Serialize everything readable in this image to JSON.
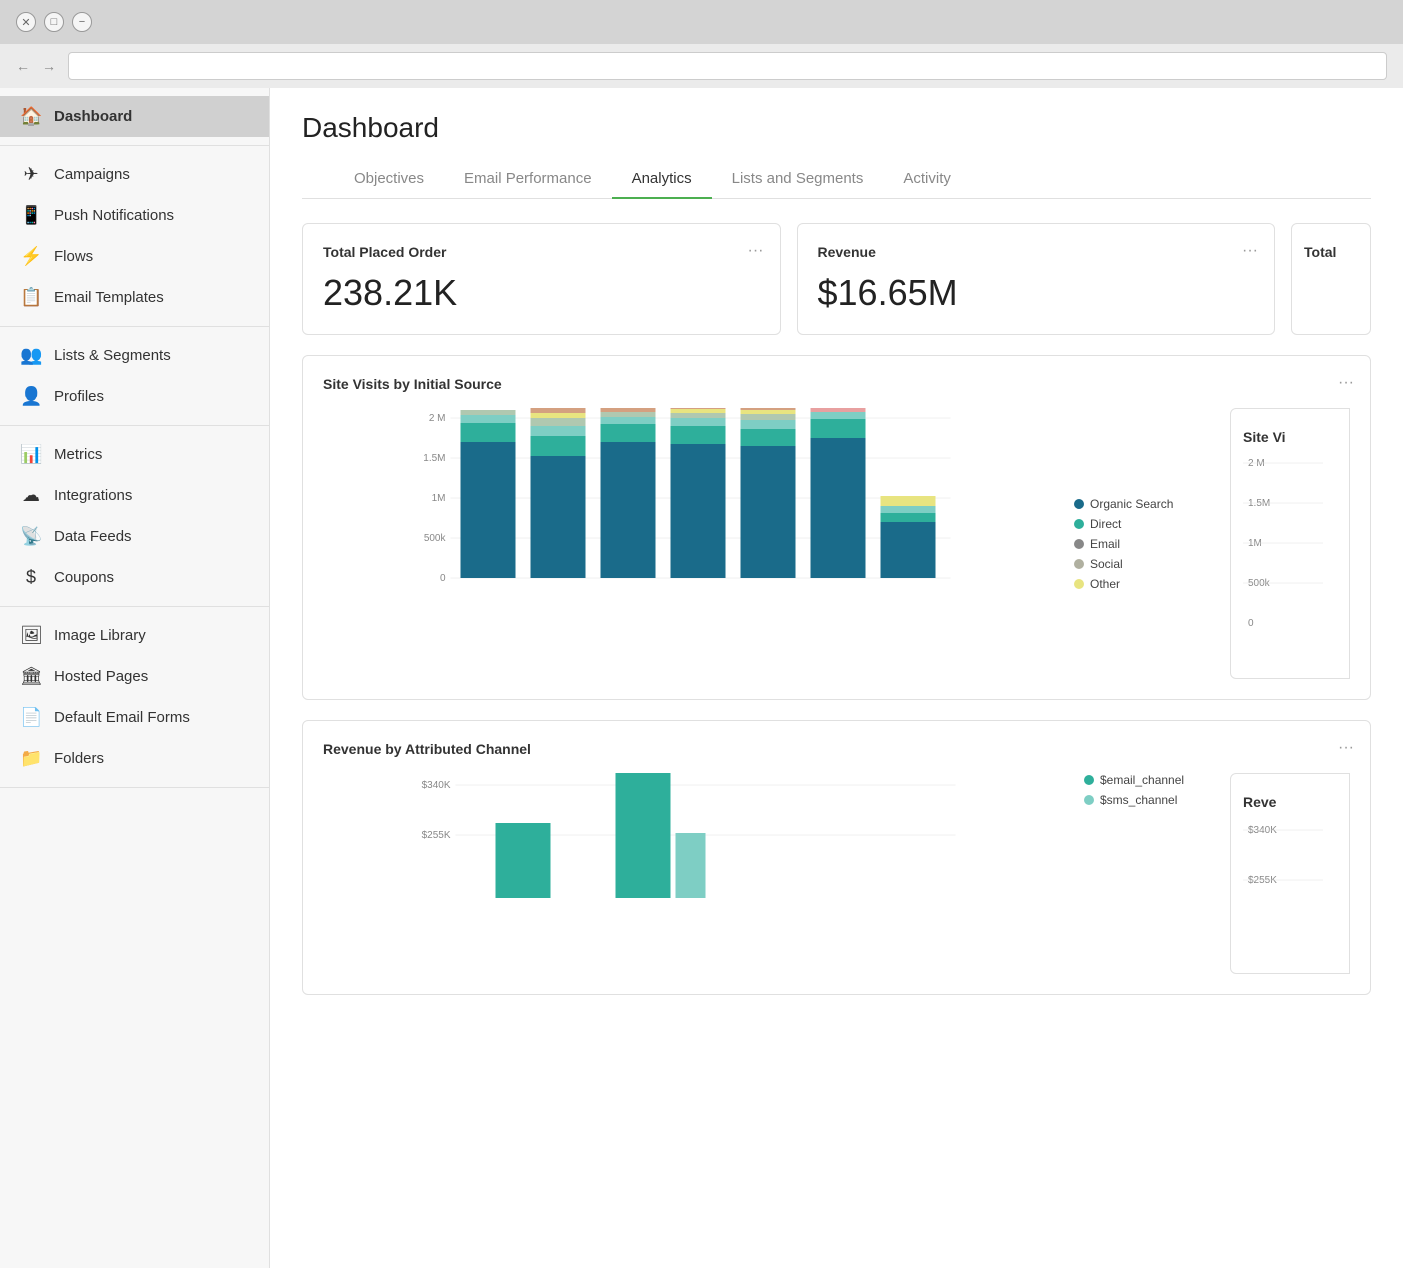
{
  "window": {
    "close_btn": "✕",
    "min_btn": "□",
    "max_btn": "−"
  },
  "nav": {
    "back": "←",
    "forward": "→"
  },
  "sidebar": {
    "sections": [
      {
        "items": [
          {
            "id": "dashboard",
            "label": "Dashboard",
            "icon": "🏠",
            "active": true
          }
        ]
      },
      {
        "items": [
          {
            "id": "campaigns",
            "label": "Campaigns",
            "icon": "✈"
          },
          {
            "id": "push-notifications",
            "label": "Push Notifications",
            "icon": "📱"
          },
          {
            "id": "flows",
            "label": "Flows",
            "icon": "⚡"
          },
          {
            "id": "email-templates",
            "label": "Email Templates",
            "icon": "📋"
          }
        ]
      },
      {
        "items": [
          {
            "id": "lists-segments",
            "label": "Lists & Segments",
            "icon": "👥"
          },
          {
            "id": "profiles",
            "label": "Profiles",
            "icon": "👤"
          }
        ]
      },
      {
        "items": [
          {
            "id": "metrics",
            "label": "Metrics",
            "icon": "📊"
          },
          {
            "id": "integrations",
            "label": "Integrations",
            "icon": "☁"
          },
          {
            "id": "data-feeds",
            "label": "Data Feeds",
            "icon": "📡"
          },
          {
            "id": "coupons",
            "label": "Coupons",
            "icon": "$"
          }
        ]
      },
      {
        "items": [
          {
            "id": "image-library",
            "label": "Image Library",
            "icon": "🖼"
          },
          {
            "id": "hosted-pages",
            "label": "Hosted Pages",
            "icon": "🏛"
          },
          {
            "id": "default-email-forms",
            "label": "Default Email Forms",
            "icon": "📄"
          },
          {
            "id": "folders",
            "label": "Folders",
            "icon": "📁"
          }
        ]
      }
    ]
  },
  "page": {
    "title": "Dashboard"
  },
  "tabs": [
    {
      "id": "objectives",
      "label": "Objectives",
      "active": false
    },
    {
      "id": "email-performance",
      "label": "Email Performance",
      "active": false
    },
    {
      "id": "analytics",
      "label": "Analytics",
      "active": true
    },
    {
      "id": "lists-segments",
      "label": "Lists and Segments",
      "active": false
    },
    {
      "id": "activity",
      "label": "Activity",
      "active": false
    }
  ],
  "metrics": [
    {
      "id": "total-placed-order",
      "label": "Total Placed Order",
      "value": "238.21K"
    },
    {
      "id": "revenue",
      "label": "Revenue",
      "value": "$16.65M"
    },
    {
      "id": "total-partial",
      "label": "Total"
    }
  ],
  "site_visits_chart": {
    "title": "Site Visits by Initial Source",
    "more": "···",
    "y_labels": [
      "2 M",
      "1.5M",
      "1M",
      "500k",
      "0"
    ],
    "legend": [
      {
        "label": "Organic Search",
        "color": "#1a6b8a"
      },
      {
        "label": "Direct",
        "color": "#2eaf9b"
      },
      {
        "label": "Email",
        "color": "#888888"
      },
      {
        "label": "Social",
        "color": "#b0b0a0"
      },
      {
        "label": "Other",
        "color": "#e8e480"
      }
    ],
    "bars": [
      {
        "segments": [
          {
            "color": "#1a6b8a",
            "pct": 38
          },
          {
            "color": "#2eaf9b",
            "pct": 28
          },
          {
            "color": "#7ecec4",
            "pct": 12
          },
          {
            "color": "#b0c8b0",
            "pct": 8
          },
          {
            "color": "#e8e480",
            "pct": 5
          },
          {
            "color": "#d4a080",
            "pct": 4
          }
        ],
        "total_pct": 80
      },
      {
        "segments": [
          {
            "color": "#1a6b8a",
            "pct": 35
          },
          {
            "color": "#2eaf9b",
            "pct": 22
          },
          {
            "color": "#7ecec4",
            "pct": 14
          },
          {
            "color": "#b0c8b0",
            "pct": 7
          },
          {
            "color": "#e8e480",
            "pct": 4
          },
          {
            "color": "#d4a080",
            "pct": 6
          }
        ],
        "total_pct": 75
      },
      {
        "segments": [
          {
            "color": "#1a6b8a",
            "pct": 38
          },
          {
            "color": "#2eaf9b",
            "pct": 25
          },
          {
            "color": "#7ecec4",
            "pct": 10
          },
          {
            "color": "#b0c8b0",
            "pct": 6
          },
          {
            "color": "#e8e480",
            "pct": 4
          },
          {
            "color": "#d4a080",
            "pct": 5
          }
        ],
        "total_pct": 78
      },
      {
        "segments": [
          {
            "color": "#1a6b8a",
            "pct": 37
          },
          {
            "color": "#2eaf9b",
            "pct": 24
          },
          {
            "color": "#7ecec4",
            "pct": 11
          },
          {
            "color": "#b0c8b0",
            "pct": 7
          },
          {
            "color": "#e8e480",
            "pct": 5
          },
          {
            "color": "#d4a080",
            "pct": 4
          }
        ],
        "total_pct": 77
      },
      {
        "segments": [
          {
            "color": "#1a6b8a",
            "pct": 36
          },
          {
            "color": "#2eaf9b",
            "pct": 23
          },
          {
            "color": "#7ecec4",
            "pct": 13
          },
          {
            "color": "#b0c8b0",
            "pct": 7
          },
          {
            "color": "#e8e480",
            "pct": 4
          },
          {
            "color": "#d4a080",
            "pct": 5
          }
        ],
        "total_pct": 76
      },
      {
        "segments": [
          {
            "color": "#1a6b8a",
            "pct": 39
          },
          {
            "color": "#2eaf9b",
            "pct": 30
          },
          {
            "color": "#7ecec4",
            "pct": 12
          },
          {
            "color": "#b0c8b0",
            "pct": 6
          },
          {
            "color": "#e8e480",
            "pct": 3
          },
          {
            "color": "#e8a0a0",
            "pct": 5
          }
        ],
        "total_pct": 82
      },
      {
        "segments": [
          {
            "color": "#1a6b8a",
            "pct": 20
          },
          {
            "color": "#2eaf9b",
            "pct": 5
          },
          {
            "color": "#7ecec4",
            "pct": 4
          },
          {
            "color": "#e8e480",
            "pct": 8
          }
        ],
        "total_pct": 32
      }
    ]
  },
  "revenue_chart": {
    "title": "Revenue by Attributed Channel",
    "more": "···",
    "y_labels": [
      "$340K",
      "$255K"
    ],
    "legend": [
      {
        "label": "$email_channel",
        "color": "#2eaf9b"
      },
      {
        "label": "$sms_channel",
        "color": "#7ecec4"
      }
    ]
  },
  "partial_right": {
    "site_visits_label": "Site Vi",
    "revenue_label": "Reve",
    "y_labels_site": [
      "2 M",
      "1.5M",
      "1M",
      "500k",
      "0"
    ],
    "y_labels_rev": [
      "$340K",
      "$255K"
    ]
  }
}
